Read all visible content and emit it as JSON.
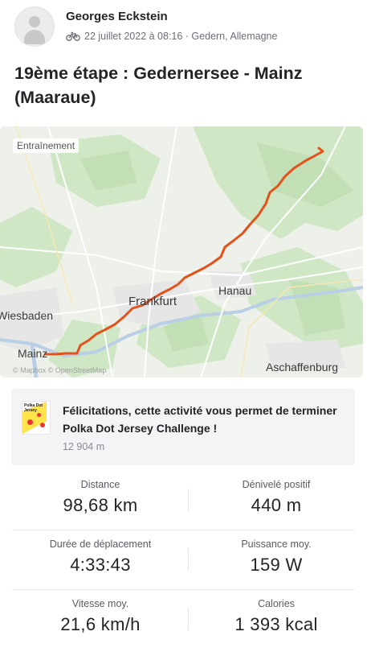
{
  "activity": {
    "athlete_name": "Georges Eckstein",
    "date_location": "22 juillet 2022 à 08:16 · Gedern, Allemagne",
    "sport_icon": "bike-icon",
    "title": "19ème étape : Gedernersee - Mainz (Maaraue)"
  },
  "map": {
    "badge": "Entraînement",
    "route_color": "#e4521b",
    "cities": {
      "frankfurt": "Frankfurt",
      "hanau": "Hanau",
      "wiesbaden": "Wiesbaden",
      "mainz": "Mainz",
      "aschaffenburg": "Aschaffenburg"
    },
    "attribution": "© Mapbox © OpenStreetMap"
  },
  "achievement": {
    "text": "Félicitations, cette activité vous permet de terminer Polka Dot Jersey Challenge !",
    "sub": "12 904 m",
    "badge_label": "Polka Dot Jersey"
  },
  "stats": [
    {
      "label": "Distance",
      "value": "98,68 km"
    },
    {
      "label": "Dénivelé positif",
      "value": "440 m"
    },
    {
      "label": "Durée de déplacement",
      "value": "4:33:43"
    },
    {
      "label": "Puissance moy.",
      "value": "159 W"
    },
    {
      "label": "Vitesse moy.",
      "value": "21,6 km/h"
    },
    {
      "label": "Calories",
      "value": "1 393 kcal"
    }
  ]
}
